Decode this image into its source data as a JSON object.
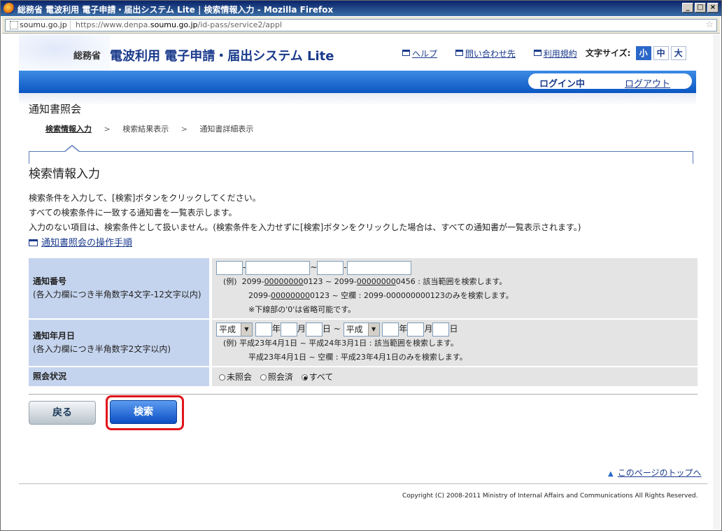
{
  "browser": {
    "title": "総務省 電波利用 電子申請・届出システム Lite | 検索情報入力 - Mozilla Firefox",
    "site_label": "soumu.go.jp",
    "url_prefix": "https://www.denpa.",
    "url_domain": "soumu.go.jp",
    "url_path": "/id-pass/service2/appl",
    "min_glyph": "_",
    "max_glyph": "□",
    "close_glyph": "×",
    "star_glyph": "☆"
  },
  "header": {
    "ministry": "総務省",
    "system_title": "電波利用 電子申請・届出システム Lite",
    "links": [
      "ヘルプ",
      "問い合わせ先",
      "利用規約"
    ],
    "font_size_label": "文字サイズ:",
    "font_sizes": [
      "小",
      "中",
      "大"
    ],
    "font_size_selected": "小"
  },
  "session": {
    "status": "ログイン中",
    "logout": "ログアウト"
  },
  "page": {
    "section_title": "通知書照会",
    "steps": [
      "検索情報入力",
      "検索結果表示",
      "通知書詳細表示"
    ],
    "step_separator": ">",
    "current_step": 0,
    "heading": "検索情報入力",
    "intro_lines": [
      "検索条件を入力して、[検索]ボタンをクリックしてください。",
      "すべての検索条件に一致する通知書を一覧表示します。",
      "入力のない項目は、検索条件として扱いません。(検索条件を入力せずに[検索]ボタンをクリックした場合は、すべての通知書が一覧表示されます。)"
    ],
    "manual_link": "通知書照会の操作手順"
  },
  "form": {
    "notice_number": {
      "label": "通知番号",
      "sub_label": "(各入力欄につき半角数字4文字-12文字以内)",
      "dash": "-",
      "tilde": "~",
      "example_prefix": "(例)",
      "ex1_a": "2099-",
      "ex1_a_u": "00000000",
      "ex1_a_rest": "0123",
      "ex1_sep": " ~ ",
      "ex1_b": "2099-",
      "ex1_b_u": "00000000",
      "ex1_b_rest": "0456",
      "ex1_desc": " : 該当範囲を検索します。",
      "ex2_a": "2099-",
      "ex2_a_u": "00000000",
      "ex2_a_rest": "0123",
      "ex2_rest": " ~ 空欄 : 2099-000000000123のみを検索します。",
      "note": "※下線部の'0'は省略可能です。"
    },
    "notice_date": {
      "label": "通知年月日",
      "sub_label": "(各入力欄につき半角数字2文字以内)",
      "era": "平成",
      "year": "年",
      "month": "月",
      "day": "日",
      "tilde": "~",
      "example_prefix": "(例)",
      "ex1": "平成23年4月1日 ~ 平成24年3月1日 : 該当範囲を検索します。",
      "ex2": "平成23年4月1日 ~ 空欄 : 平成23年4月1日のみを検索します。"
    },
    "status": {
      "label": "照会状況",
      "options": [
        "未照会",
        "照会済",
        "すべて"
      ],
      "selected": "すべて"
    }
  },
  "buttons": {
    "back": "戻る",
    "search": "検索"
  },
  "footer": {
    "to_top": "このページのトップへ",
    "copyright": "Copyright (C) 2008-2011 Ministry of Internal Affairs and Communications All Rights Reserved."
  }
}
